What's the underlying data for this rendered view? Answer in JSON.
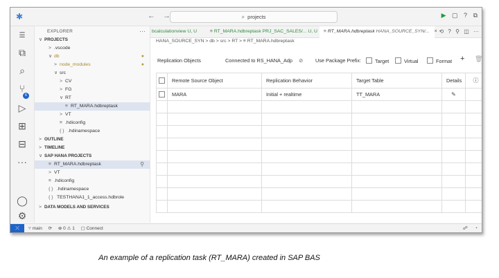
{
  "titlebar": {
    "nav": "← →",
    "search_icon": "search-icon",
    "search_text": "projects",
    "actions": [
      "▶",
      "▢",
      "?",
      "⧉"
    ]
  },
  "sidebar": {
    "header": "EXPLORER",
    "more": "···",
    "rows": [
      {
        "text": "PROJECTS",
        "indent": 6,
        "arrow": "∨",
        "section": true
      },
      {
        "text": ".vscode",
        "indent": 20,
        "arrow": ">"
      },
      {
        "text": "db",
        "indent": 20,
        "arrow": "∨",
        "color": "gold",
        "dot": true
      },
      {
        "text": "node_modules",
        "indent": 28,
        "arrow": ">",
        "color": "gold",
        "dot": true
      },
      {
        "text": "src",
        "indent": 28,
        "arrow": "∨"
      },
      {
        "text": "CV",
        "indent": 36,
        "arrow": ">"
      },
      {
        "text": "FG",
        "indent": 36,
        "arrow": ">"
      },
      {
        "text": "RT",
        "indent": 36,
        "arrow": "∨"
      },
      {
        "text": "RT_MARA.hdbreptask",
        "indent": 44,
        "arrow": "≡",
        "selected": true
      },
      {
        "text": "VT",
        "indent": 36,
        "arrow": ">"
      },
      {
        "text": ".hdiconfig",
        "indent": 36,
        "arrow": "≡"
      },
      {
        "text": ".hdinamespace",
        "indent": 36,
        "arrow": "{ }"
      },
      {
        "text": "OUTLINE",
        "indent": 6,
        "arrow": ">",
        "section": true
      },
      {
        "text": "TIMELINE",
        "indent": 6,
        "arrow": ">",
        "section": true
      },
      {
        "text": "SAP HANA PROJECTS",
        "indent": 6,
        "arrow": "∨",
        "section": true
      },
      {
        "text": "RT_MARA.hdbreptask",
        "indent": 20,
        "arrow": "≡",
        "selected": true,
        "pin": true
      },
      {
        "text": "VT",
        "indent": 20,
        "arrow": ">"
      },
      {
        "text": ".hdiconfig",
        "indent": 20,
        "arrow": "≡"
      },
      {
        "text": ".hdinamespace",
        "indent": 20,
        "arrow": "{ }"
      },
      {
        "text": "TESTHANA1_1_access.hdbrole",
        "indent": 20,
        "arrow": "{ }"
      },
      {
        "text": "DATA MODELS AND SERVICES",
        "indent": 6,
        "arrow": ">",
        "section": true
      }
    ]
  },
  "tabs": [
    {
      "label": "bcalculationview",
      "suffix": "U, U",
      "green": true
    },
    {
      "label": "RT_MARA.hdbreptask",
      "suffix": "PRJ_SAC_SALES/... U, U",
      "green": true,
      "icon": "≡"
    },
    {
      "label": "RT_MARA.hdbreptask",
      "suffix": "HANA_SOURCE_SYN/...",
      "italic": true,
      "active": true,
      "icon": "≡",
      "close": "×"
    }
  ],
  "breadcrumb": "HANA_SOURCE_SYN  >  db  >  src  >  RT  >  ≡  RT_MARA.hdbreptask",
  "toolbar": {
    "title": "Replication Objects",
    "connection": "Connected to RS_HANA_Adp",
    "package_prefix": "Use Package Prefix:",
    "target": "Target",
    "virtual": "Virtual",
    "format": "Format",
    "add": "+",
    "delete": "🗑"
  },
  "grid": {
    "columns": [
      "Remote Source Object",
      "Replication Behavior",
      "Target Table",
      "Details"
    ],
    "rows": [
      {
        "remote": "MARA",
        "behavior": "Initial + realtime",
        "target": "TT_MARA"
      }
    ],
    "empty_rows": 9
  },
  "statusbar": {
    "branch": "main",
    "problems": "⊗ 0  ⚠ 1",
    "connect": "Connect"
  },
  "caption": "An example of a replication task (RT_MARA) created in SAP BAS"
}
